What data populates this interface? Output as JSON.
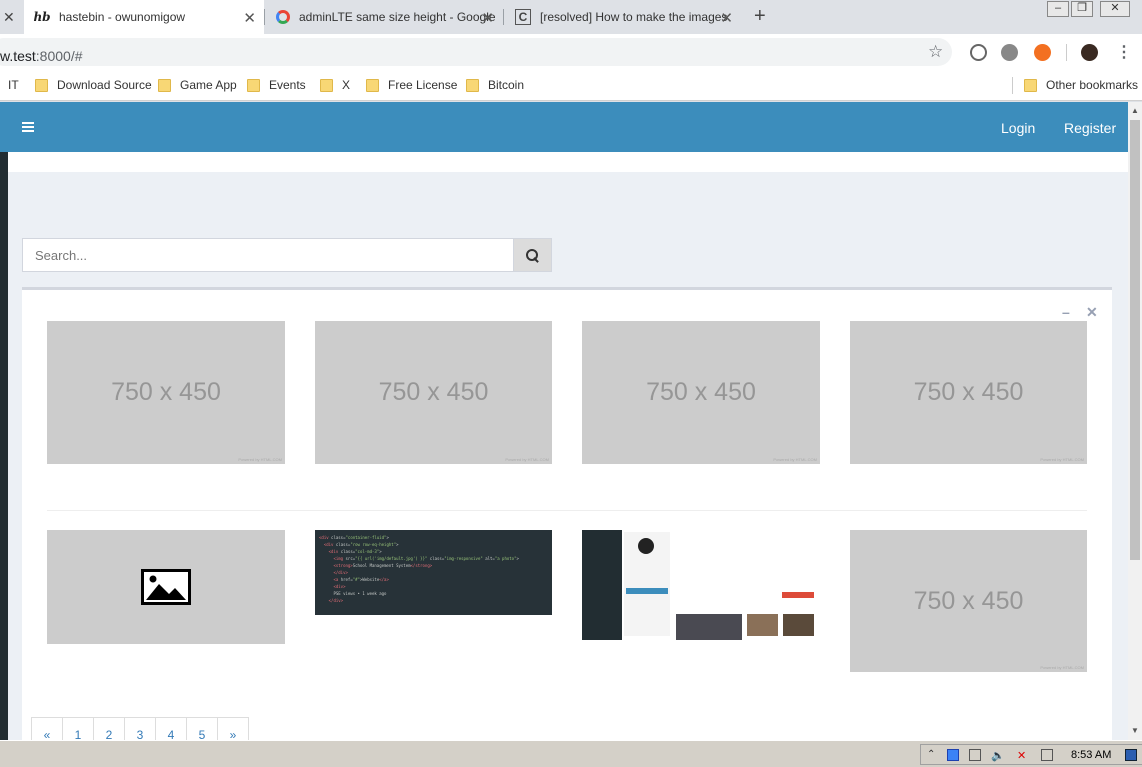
{
  "browser": {
    "tabs": [
      {
        "title": "hastebin - owunomigow",
        "favicon": "hb"
      },
      {
        "title": "adminLTE same size height - Google",
        "favicon": "google-icon"
      },
      {
        "title": "[resolved] How to make the images",
        "favicon": "doc-icon"
      }
    ],
    "url_host": "w.test",
    "url_rest": ":8000/#",
    "bookmarks": [
      "IT",
      "Download Source",
      "Game App",
      "Events",
      "X",
      "Free License",
      "Bitcoin"
    ],
    "other_bookmarks": "Other bookmarks"
  },
  "navbar": {
    "login": "Login",
    "register": "Register"
  },
  "search": {
    "placeholder": "Search..."
  },
  "gallery": {
    "placeholder_text": "750 x 450",
    "powered": "Powered by HTML.COM"
  },
  "pagination": [
    "«",
    "1",
    "2",
    "3",
    "4",
    "5",
    "»"
  ],
  "taskbar": {
    "clock": "8:53 AM"
  },
  "colors": {
    "navbar": "#3c8dbc",
    "content_bg": "#ecf0f5",
    "placeholder_bg": "#cccccc",
    "link": "#337ab7"
  }
}
